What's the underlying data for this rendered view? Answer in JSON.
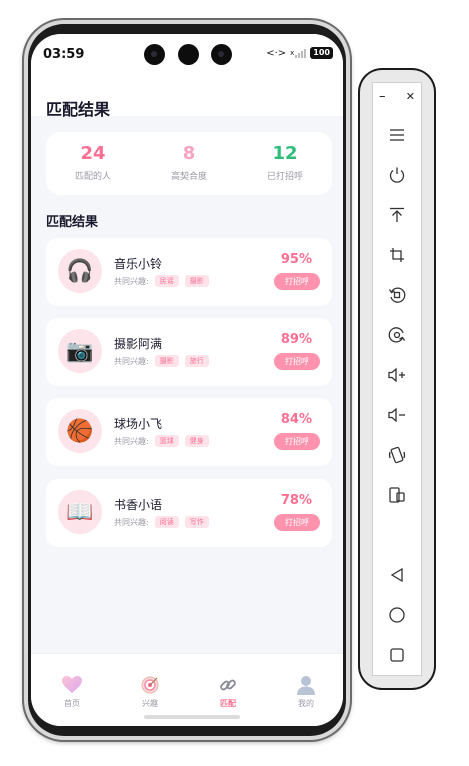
{
  "status_bar": {
    "time": "03:59",
    "network": "<·>",
    "network_type": "x",
    "battery": "100"
  },
  "header": {
    "title": "匹配结果"
  },
  "stats": [
    {
      "value": "24",
      "label": "匹配的人",
      "color": "#ff6f91"
    },
    {
      "value": "8",
      "label": "高契合度",
      "color": "#f9a4c0"
    },
    {
      "value": "12",
      "label": "已打招呼",
      "color": "#2ebd7a"
    }
  ],
  "section_title": "匹配结果",
  "interest_label": "共同兴趣:",
  "greet_label": "打招呼",
  "matches": [
    {
      "name": "音乐小铃",
      "percent": "95%",
      "avatar": "🎧",
      "avatar_name": "headphones-icon",
      "tags": [
        "民谣",
        "摄影"
      ]
    },
    {
      "name": "摄影阿满",
      "percent": "89%",
      "avatar": "📷",
      "avatar_name": "camera-icon",
      "tags": [
        "摄影",
        "旅行"
      ]
    },
    {
      "name": "球场小飞",
      "percent": "84%",
      "avatar": "🏀",
      "avatar_name": "basketball-icon",
      "tags": [
        "篮球",
        "健身"
      ]
    },
    {
      "name": "书香小语",
      "percent": "78%",
      "avatar": "📖",
      "avatar_name": "book-icon",
      "tags": [
        "阅读",
        "写作"
      ]
    }
  ],
  "tabs": [
    {
      "label": "首页",
      "icon": "heart-icon"
    },
    {
      "label": "兴趣",
      "icon": "target-icon"
    },
    {
      "label": "匹配",
      "icon": "link-icon",
      "active": true
    },
    {
      "label": "我的",
      "icon": "user-icon"
    }
  ],
  "emulator_toolbar": {
    "buttons": [
      "minimize-icon",
      "close-icon",
      "menu-icon",
      "power-icon",
      "install-apk-icon",
      "crop-icon",
      "rotate-left-icon",
      "rotate-right-icon",
      "volume-up-icon",
      "volume-down-icon",
      "shake-icon",
      "screenshot-icon",
      "back-icon",
      "home-icon",
      "recents-icon"
    ],
    "minimize": "–",
    "close": "✕"
  },
  "colors": {
    "accent": "#ff6f91",
    "tag_bg": "#ffe3ea",
    "green": "#2ebd7a",
    "screen_bg": "#f5f6fa"
  }
}
